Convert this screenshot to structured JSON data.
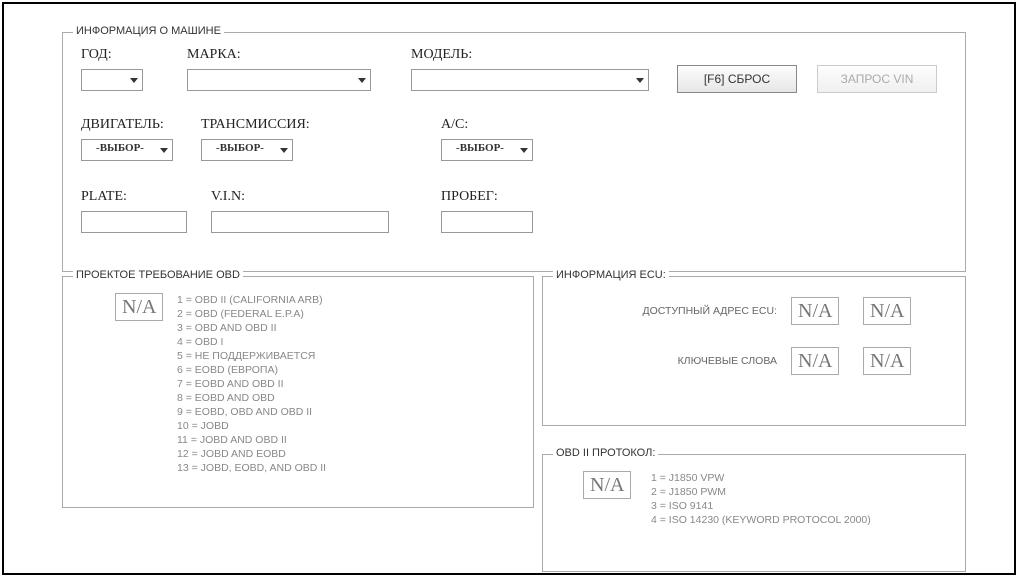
{
  "vehicle": {
    "section_title": "ИНФОРМАЦИЯ О МАШИНЕ",
    "year_label": "ГОД:",
    "make_label": "МАРКА:",
    "model_label": "МОДЕЛЬ:",
    "engine_label": "ДВИГАТЕЛЬ:",
    "trans_label": "ТРАНСМИССИЯ:",
    "ac_label": "A/C:",
    "plate_label": "PLATE:",
    "vin_label": "V.I.N:",
    "mileage_label": "ПРОБЕГ:",
    "placeholder_select": "-ВЫБОР-",
    "year_value": "",
    "make_value": "",
    "model_value": "",
    "engine_value": "-ВЫБОР-",
    "trans_value": "-ВЫБОР-",
    "ac_value": "-ВЫБОР-",
    "plate_value": "",
    "vin_value": "",
    "mileage_value": "",
    "reset_button": "[F6] СБРОС",
    "request_vin_button": "ЗАПРОС VIN"
  },
  "obd_req": {
    "section_title": "ПРОЕКТОЕ ТРЕБОВАНИЕ OBD",
    "na": "N/A",
    "l1": "1 = OBD II (CALIFORNIA ARB)",
    "l2": "2 = OBD (FEDERAL E.P.A)",
    "l3": "3 = OBD AND OBD II",
    "l4": "4 = OBD I",
    "l5": "5 = НЕ ПОДДЕРЖИВАЕТСЯ",
    "l6": "6 = EOBD (ЕВРОПА)",
    "l7": "7 = EOBD AND OBD II",
    "l8": "8 = EOBD AND OBD",
    "l9": "9 = EOBD, OBD AND OBD II",
    "l10": "10 = JOBD",
    "l11": "11 = JOBD AND OBD II",
    "l12": "12 = JOBD AND EOBD",
    "l13": "13 = JOBD, EOBD, AND OBD II"
  },
  "ecu": {
    "section_title": "ИНФОРМАЦИЯ  ECU:",
    "addr_label": "ДОСТУПНЫЙ АДРЕС ECU:",
    "keywords_label": "КЛЮЧЕВЫЕ СЛОВА",
    "na": "N/A"
  },
  "proto": {
    "section_title": "OBD II ПРОТОКОЛ:",
    "na": "N/A",
    "l1": "1 = J1850 VPW",
    "l2": "2 = J1850 PWM",
    "l3": "3 = ISO 9141",
    "l4": "4 = ISO 14230 (KEYWORD PROTOCOL 2000)"
  }
}
